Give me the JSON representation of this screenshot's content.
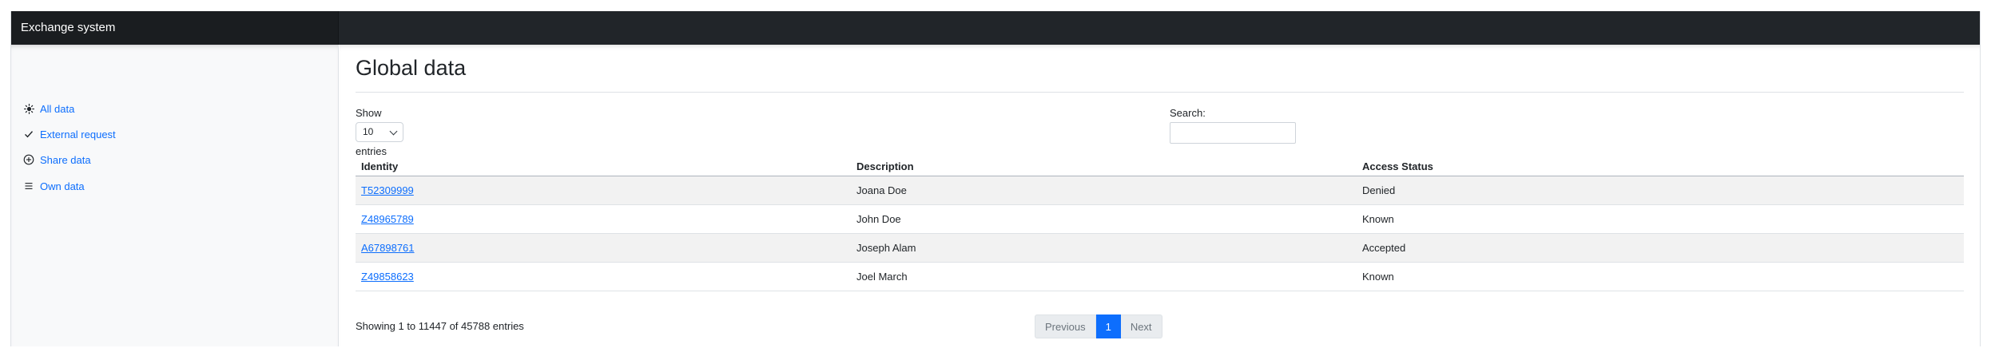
{
  "app": {
    "title": "Exchange system"
  },
  "sidebar": {
    "items": [
      {
        "label": "All data",
        "icon": "sun-icon"
      },
      {
        "label": "External request",
        "icon": "check-icon"
      },
      {
        "label": "Share data",
        "icon": "plus-circle-icon"
      },
      {
        "label": "Own data",
        "icon": "list-icon"
      }
    ]
  },
  "main": {
    "title": "Global data",
    "show_label": "Show",
    "page_length": "10",
    "entries_label": "entries",
    "search_label": "Search:",
    "search_value": "",
    "table": {
      "columns": [
        "Identity",
        "Description",
        "Access Status"
      ],
      "rows": [
        {
          "identity": "T52309999",
          "description": "Joana Doe",
          "status": "Denied"
        },
        {
          "identity": "Z48965789",
          "description": "John Doe",
          "status": "Known"
        },
        {
          "identity": "A67898761",
          "description": "Joseph Alam",
          "status": "Accepted"
        },
        {
          "identity": "Z49858623",
          "description": "Joel March",
          "status": "Known"
        }
      ]
    },
    "info": "Showing 1 to 11447 of 45788 entries",
    "pagination": {
      "previous": "Previous",
      "current": "1",
      "next": "Next"
    }
  },
  "colors": {
    "topbar": "#212529",
    "link": "#0d6efd",
    "sidebar_bg": "#f8f9fa",
    "active_page": "#0d6efd"
  }
}
